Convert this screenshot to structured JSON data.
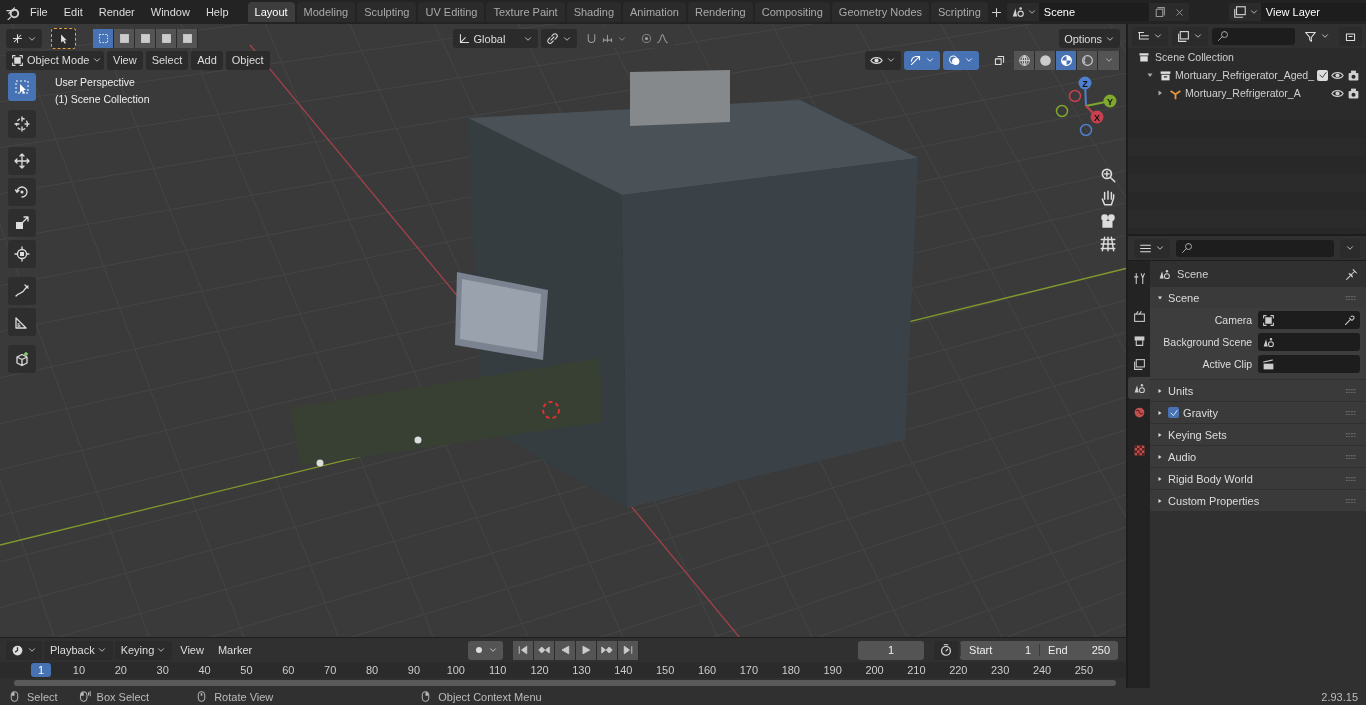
{
  "top_bar": {
    "menus": [
      "File",
      "Edit",
      "Render",
      "Window",
      "Help"
    ],
    "workspaces": [
      {
        "label": "Layout",
        "selected": true
      },
      {
        "label": "Modeling",
        "selected": false
      },
      {
        "label": "Sculpting",
        "selected": false
      },
      {
        "label": "UV Editing",
        "selected": false
      },
      {
        "label": "Texture Paint",
        "selected": false
      },
      {
        "label": "Shading",
        "selected": false
      },
      {
        "label": "Animation",
        "selected": false
      },
      {
        "label": "Rendering",
        "selected": false
      },
      {
        "label": "Compositing",
        "selected": false
      },
      {
        "label": "Geometry Nodes",
        "selected": false
      },
      {
        "label": "Scripting",
        "selected": false
      }
    ],
    "scene": "Scene",
    "view_layer": "View Layer"
  },
  "viewport": {
    "select_modes": [
      {
        "selected": true
      },
      {
        "selected": false
      },
      {
        "selected": false
      },
      {
        "selected": false
      },
      {
        "selected": false
      }
    ],
    "transform_orientation": "Global",
    "options": "Options",
    "mode": "Object Mode",
    "menus": [
      "View",
      "Select",
      "Add",
      "Object"
    ],
    "snap_on": false,
    "proportional_on": false,
    "gizmos_on": true,
    "overlays_on": true,
    "shading": [
      {
        "kind": "wireframe",
        "selected": false
      },
      {
        "kind": "solid",
        "selected": false
      },
      {
        "kind": "material",
        "selected": true
      },
      {
        "kind": "rendered",
        "selected": false
      }
    ],
    "tools": [
      {
        "kind": "select-box",
        "selected": true
      },
      {
        "kind": "cursor",
        "selected": false
      },
      {
        "kind": "move",
        "selected": false
      },
      {
        "kind": "rotate",
        "selected": false
      },
      {
        "kind": "scale",
        "selected": false
      },
      {
        "kind": "transform",
        "selected": false
      },
      {
        "kind": "annotate",
        "selected": false
      },
      {
        "kind": "measure",
        "selected": false
      },
      {
        "kind": "add-cube",
        "selected": false
      }
    ],
    "overlay_text": [
      "User Perspective",
      "(1) Scene Collection"
    ],
    "gizmo_axes": [
      "Z",
      "Y",
      "X"
    ]
  },
  "outliner": {
    "tree": [
      {
        "label": "Scene Collection",
        "kind": "scene-collection",
        "children": [
          {
            "label": "Mortuary_Refrigerator_Aged_",
            "kind": "collection",
            "expanded": true,
            "checked": true,
            "children": [
              {
                "label": "Mortuary_Refrigerator_A",
                "kind": "object",
                "expanded": false
              }
            ]
          }
        ]
      }
    ]
  },
  "properties": {
    "tabs": [
      {
        "kind": "tool",
        "selected": false
      },
      {
        "kind": "render",
        "selected": false
      },
      {
        "kind": "output",
        "selected": false
      },
      {
        "kind": "view-layer",
        "selected": false
      },
      {
        "kind": "scene",
        "selected": true
      },
      {
        "kind": "world",
        "selected": false
      },
      {
        "kind": "texture",
        "selected": false
      }
    ],
    "context": "Scene",
    "panels": [
      {
        "title": "Scene",
        "expanded": true,
        "fields": [
          {
            "label": "Camera",
            "kind": "camera"
          },
          {
            "label": "Background Scene",
            "kind": "scene"
          },
          {
            "label": "Active Clip",
            "kind": "clip"
          }
        ]
      },
      {
        "title": "Units",
        "expanded": false
      },
      {
        "title": "Gravity",
        "expanded": false,
        "checked": true
      },
      {
        "title": "Keying Sets",
        "expanded": false
      },
      {
        "title": "Audio",
        "expanded": false
      },
      {
        "title": "Rigid Body World",
        "expanded": false
      },
      {
        "title": "Custom Properties",
        "expanded": false
      }
    ]
  },
  "timeline": {
    "menus": [
      {
        "label": "Playback",
        "kind": "dropdown"
      },
      {
        "label": "Keying",
        "kind": "dropdown"
      },
      {
        "label": "View",
        "kind": "menu"
      },
      {
        "label": "Marker",
        "kind": "menu"
      }
    ],
    "current_frame": "1",
    "start_label": "Start",
    "start": "1",
    "end_label": "End",
    "end": "250",
    "playhead": "1",
    "ticks": [
      "10",
      "20",
      "30",
      "40",
      "50",
      "60",
      "70",
      "80",
      "90",
      "100",
      "110",
      "120",
      "130",
      "140",
      "150",
      "160",
      "170",
      "180",
      "190",
      "200",
      "210",
      "220",
      "230",
      "240",
      "250"
    ]
  },
  "status_bar": {
    "items": [
      {
        "label": "Select",
        "kind": "left-click"
      },
      {
        "label": "Box Select",
        "kind": "drag"
      },
      {
        "label": "Rotate View",
        "kind": "middle-click"
      },
      {
        "label": "Object Context Menu",
        "kind": "right-click"
      }
    ],
    "version": "2.93.15"
  }
}
